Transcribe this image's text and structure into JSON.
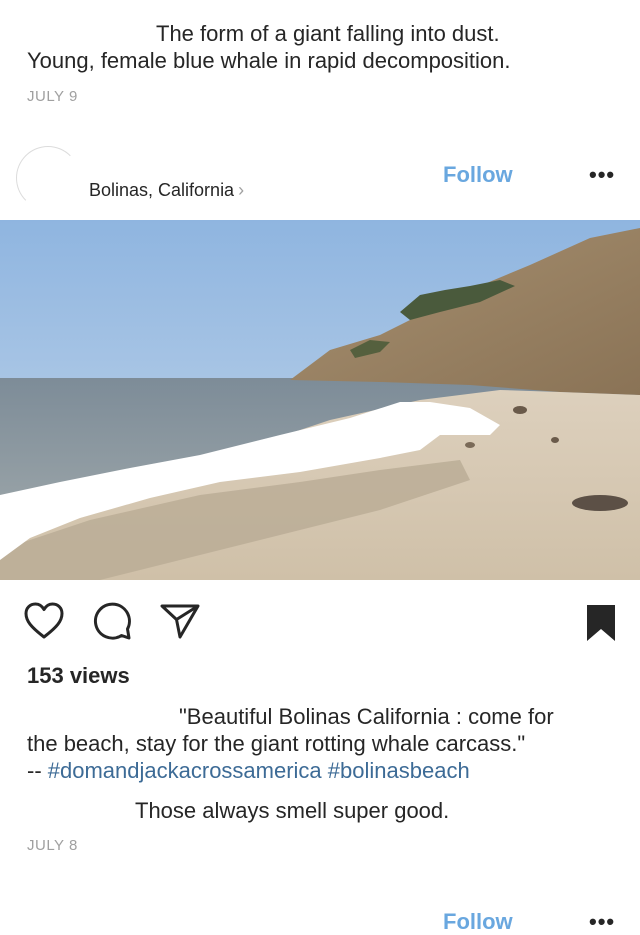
{
  "post_prev": {
    "caption_line1": "The form of a giant falling into dust.",
    "caption_line2": "Young, female blue whale in rapid decomposition.",
    "date": "JULY 9"
  },
  "post": {
    "location": "Bolinas, California",
    "location_chevron": "›",
    "follow_label": "Follow",
    "more_label": "•••",
    "views": "153 views",
    "caption_line1": "\"Beautiful Bolinas California : come for",
    "caption_line2": "the beach, stay for the giant rotting whale carcass.\"",
    "caption_prefix": "-- ",
    "hashtag1": "#domandjackacrossamerica",
    "hashtag2": "#bolinasbeach",
    "comment": "Those always smell super good.",
    "date": "JULY 8"
  },
  "next_post": {
    "follow_label": "Follow",
    "more_label": "•••"
  },
  "icons": {
    "like": "heart-icon",
    "comment": "comment-icon",
    "share": "send-icon",
    "save": "bookmark-icon"
  },
  "colors": {
    "follow": "#69a7df",
    "hashtag": "#3d6b96",
    "date": "#a0a0a0"
  }
}
